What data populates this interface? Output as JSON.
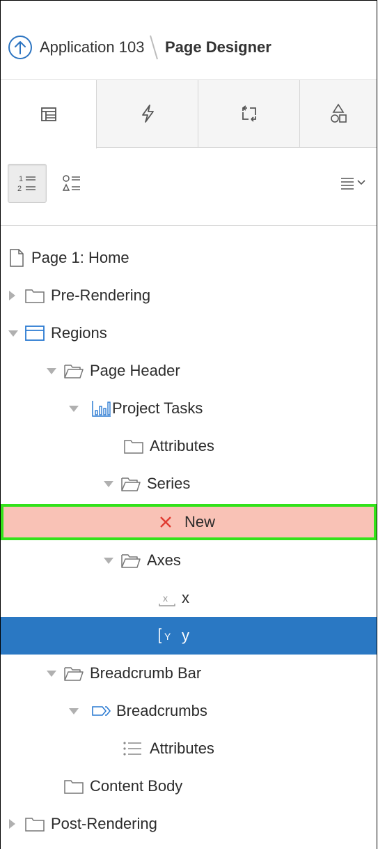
{
  "header": {
    "app_title": "Application 103",
    "page_title": "Page Designer"
  },
  "tabs": [
    {
      "name": "rendering",
      "icon": "rendering-tree-icon",
      "active": true
    },
    {
      "name": "dynamic-actions",
      "icon": "lightning-icon",
      "active": false
    },
    {
      "name": "processing",
      "icon": "processing-arrows-icon",
      "active": false
    },
    {
      "name": "shared-components",
      "icon": "shapes-icon",
      "active": false
    }
  ],
  "toolbar": {
    "group_by_component_icon": "numbered-list-icon",
    "group_by_type_icon": "shapes-list-icon",
    "menu_icon": "hamburger-menu-icon"
  },
  "tree": {
    "page": "Page 1: Home",
    "pre_rendering": "Pre-Rendering",
    "regions": "Regions",
    "page_header": "Page Header",
    "project_tasks": "Project Tasks",
    "attributes_chart": "Attributes",
    "series": "Series",
    "new_series": "New",
    "axes": "Axes",
    "axis_x": "x",
    "axis_y": "y",
    "breadcrumb_bar": "Breadcrumb Bar",
    "breadcrumbs": "Breadcrumbs",
    "attributes_breadcrumb": "Attributes",
    "content_body": "Content Body",
    "post_rendering": "Post-Rendering"
  },
  "colors": {
    "accent": "#2a78c3",
    "error_bg": "#f9c2b6",
    "error_border": "#33e21a",
    "error_icon": "#e03c31"
  }
}
